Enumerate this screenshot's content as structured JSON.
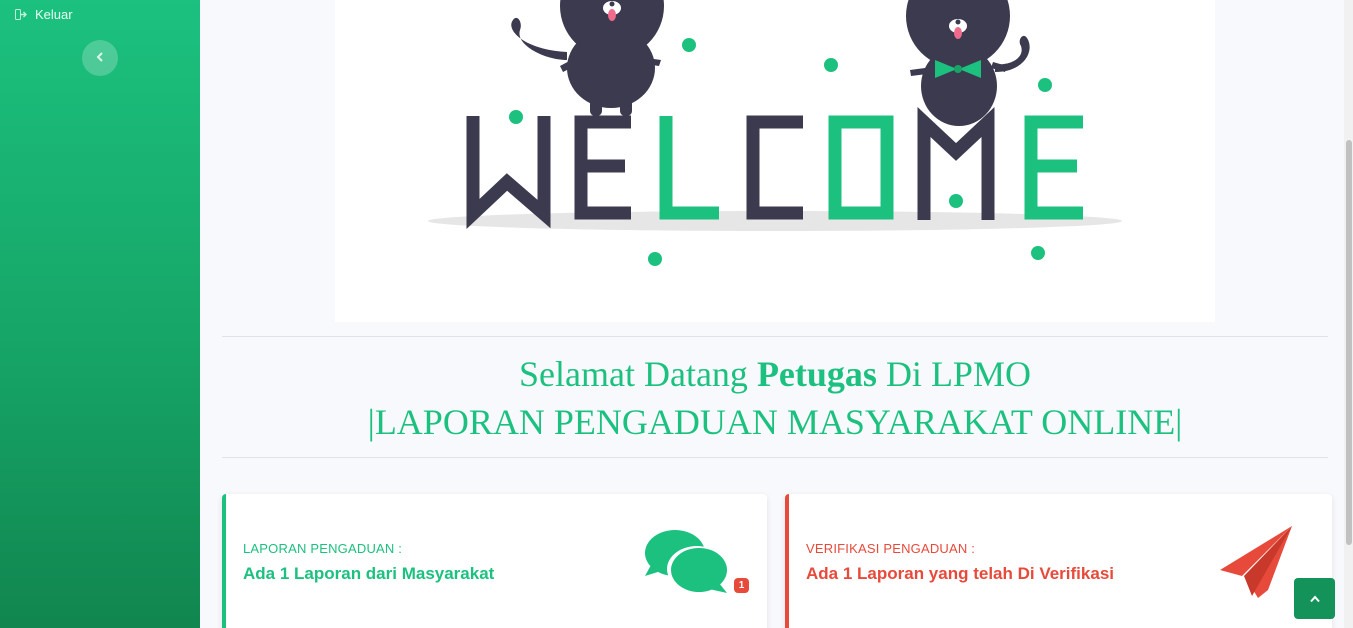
{
  "sidebar": {
    "logout_label": "Keluar",
    "logout_icon": "sign-out-icon",
    "toggle_icon": "chevron-left-icon"
  },
  "welcome_image": {
    "text": "WELCOME",
    "accent_color": "#1cc17f",
    "dark_color": "#3b3a4f"
  },
  "heading": {
    "line1_prefix": "Selamat Datang ",
    "line1_bold": "Petugas",
    "line1_suffix": " Di LPMO",
    "line2": "|LAPORAN PENGADUAN MASYARAKAT ONLINE|"
  },
  "cards": [
    {
      "label": "LAPORAN PENGADUAN :",
      "value": "Ada 1 Laporan dari Masyarakat",
      "icon": "comments-icon",
      "badge": "1",
      "color": "#1cc17f"
    },
    {
      "label": "VERIFIKASI PENGADUAN :",
      "value": "Ada 1 Laporan yang telah Di Verifikasi",
      "icon": "paper-plane-icon",
      "color": "#e74a3b"
    }
  ],
  "scroll_top": {
    "icon": "chevron-up-icon"
  },
  "colors": {
    "brand": "#1cc17f",
    "danger": "#e74a3b",
    "background": "#f8f9fc"
  }
}
